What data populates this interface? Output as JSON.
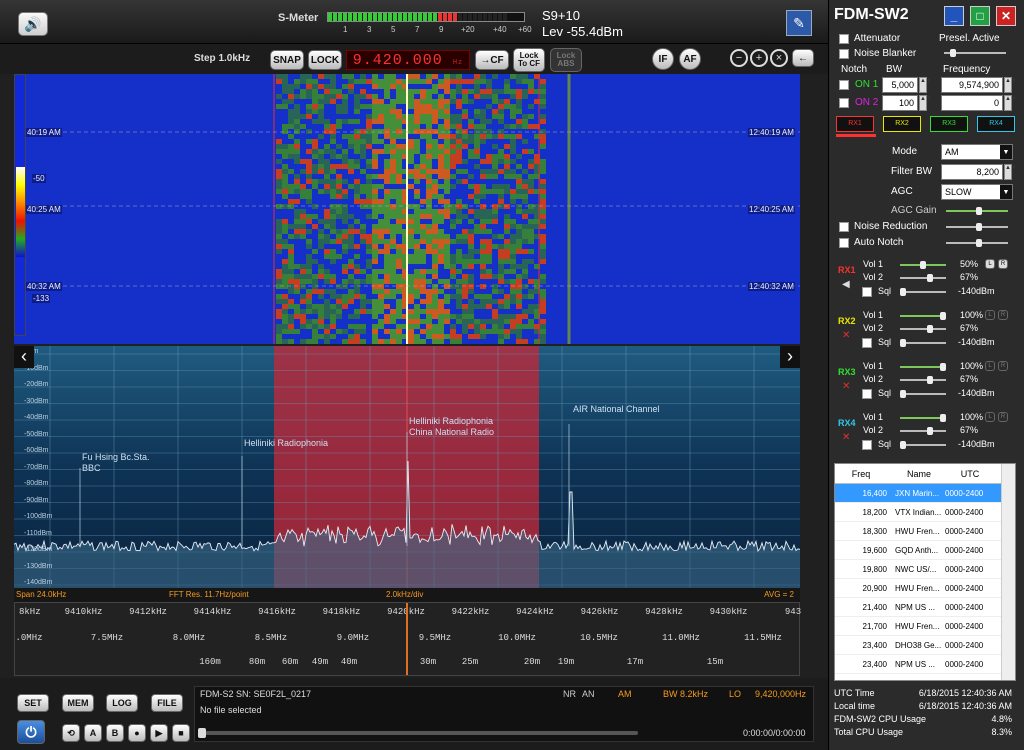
{
  "toolbar": {
    "smeter_label": "S-Meter",
    "smeter_ticks": [
      "1",
      "3",
      "5",
      "7",
      "9",
      "+20",
      "+40",
      "+60"
    ],
    "s_reading": "S9+10",
    "level": "Lev -55.4dBm",
    "step": "Step 1.0kHz",
    "snap": "SNAP",
    "lock": "LOCK",
    "frequency": "9.420.000",
    "freq_unit": "Hz",
    "cf": "→CF",
    "lock_to_cf": "Lock To CF",
    "lock_abs": "Lock ABS",
    "if": "IF",
    "af": "AF"
  },
  "waterfall": {
    "times_left": [
      "40:19 AM",
      "40:25 AM",
      "40:32 AM"
    ],
    "times_right": [
      "12:40:19 AM",
      "12:40:25 AM",
      "12:40:32 AM"
    ],
    "scale_top": "-50",
    "scale_bottom": "-133"
  },
  "spectrum": {
    "db_labels": [
      "dBm",
      "-10dBm",
      "-20dBm",
      "-30dBm",
      "-40dBm",
      "-50dBm",
      "-60dBm",
      "-70dBm",
      "-80dBm",
      "-90dBm",
      "-100dBm",
      "-110dBm",
      "-120dBm",
      "-130dBm",
      "-140dBm"
    ],
    "stations": [
      {
        "name": "Fu Hsing Bc.Sta.",
        "name2": "BBC"
      },
      {
        "name": "Helliniki Radiophonia",
        "name2": ""
      },
      {
        "name": "Helliniki Radiophonia",
        "name2": "China National Radio"
      },
      {
        "name": "AIR National Channel",
        "name2": ""
      }
    ]
  },
  "infobar": {
    "span": "Span 24.0kHz",
    "fft": "FFT Res. 11.7Hz/point",
    "div": "2.0kHz/div",
    "avg": "AVG = 2"
  },
  "axis": {
    "khz": [
      "8kHz",
      "9410kHz",
      "9412kHz",
      "9414kHz",
      "9416kHz",
      "9418kHz",
      "9420kHz",
      "9422kHz",
      "9424kHz",
      "9426kHz",
      "9428kHz",
      "9430kHz",
      "943"
    ],
    "mhz": [
      ".0MHz",
      "7.5MHz",
      "8.0MHz",
      "8.5MHz",
      "9.0MHz",
      "9.5MHz",
      "10.0MHz",
      "10.5MHz",
      "11.0MHz",
      "11.5MHz"
    ],
    "meters": [
      "160m",
      "80m",
      "60m",
      "49m",
      "40m",
      "30m",
      "25m",
      "20m",
      "19m",
      "17m",
      "15m"
    ]
  },
  "bottom": {
    "set": "SET",
    "mem": "MEM",
    "log": "LOG",
    "file": "FILE",
    "power_icon": "power-icon",
    "device": "FDM-S2 SN: SE0F2L_0217",
    "file_status": "No file selected",
    "nr": "NR",
    "an": "AN",
    "am": "AM",
    "bw": "BW 8.2kHz",
    "lo": "LO",
    "lo_freq": "9,420,000Hz",
    "time": "0:00:00/0:00:00",
    "transport": [
      "A",
      "B",
      "●",
      "▶",
      "■"
    ]
  },
  "panel": {
    "title": "FDM-SW2",
    "attenuator": "Attenuator",
    "presel": "Presel. Active",
    "noise_blanker": "Noise Blanker",
    "notch": "Notch",
    "bw": "BW",
    "frequency": "Frequency",
    "on1": "ON 1",
    "on2": "ON 2",
    "bw1": "5,000",
    "bw2": "100",
    "freq1": "9,574,900",
    "freq2": "0",
    "rx": [
      "RX1",
      "RX2",
      "RX3",
      "RX4"
    ],
    "mode_label": "Mode",
    "mode": "AM",
    "filter_label": "Filter BW",
    "filter": "8,200",
    "agc_label": "AGC",
    "agc": "SLOW",
    "agc_gain": "AGC Gain",
    "noise_reduction": "Noise Reduction",
    "auto_notch": "Auto Notch",
    "vol1": "Vol 1",
    "vol2": "Vol 2",
    "sql": "Sql",
    "rx_blocks": [
      {
        "name": "RX1",
        "v1": "50%",
        "v2": "67%",
        "sql": "-140dBm",
        "color": "#ff3030"
      },
      {
        "name": "RX2",
        "v1": "100%",
        "v2": "67%",
        "sql": "-140dBm",
        "color": "#e8e800"
      },
      {
        "name": "RX3",
        "v1": "100%",
        "v2": "67%",
        "sql": "-140dBm",
        "color": "#30e030"
      },
      {
        "name": "RX4",
        "v1": "100%",
        "v2": "67%",
        "sql": "-140dBm",
        "color": "#30c8e8"
      }
    ]
  },
  "table": {
    "headers": [
      "Freq",
      "Name",
      "UTC"
    ],
    "rows": [
      [
        "16,400",
        "JXN Marin...",
        "0000-2400"
      ],
      [
        "18,200",
        "VTX Indian...",
        "0000-2400"
      ],
      [
        "18,300",
        "HWU Fren...",
        "0000-2400"
      ],
      [
        "19,600",
        "GQD Anth...",
        "0000-2400"
      ],
      [
        "19,800",
        "NWC US/...",
        "0000-2400"
      ],
      [
        "20,900",
        "HWU Fren...",
        "0000-2400"
      ],
      [
        "21,400",
        "NPM US ...",
        "0000-2400"
      ],
      [
        "21,700",
        "HWU Fren...",
        "0000-2400"
      ],
      [
        "23,400",
        "DHO38 Ge...",
        "0000-2400"
      ],
      [
        "23,400",
        "NPM US ...",
        "0000-2400"
      ]
    ]
  },
  "footer": [
    [
      "UTC Time",
      "6/18/2015 12:40:36 AM"
    ],
    [
      "Local time",
      "6/18/2015 12:40:36 AM"
    ],
    [
      "FDM-SW2 CPU Usage",
      "4.8%"
    ],
    [
      "Total CPU Usage",
      "8.3%"
    ]
  ]
}
